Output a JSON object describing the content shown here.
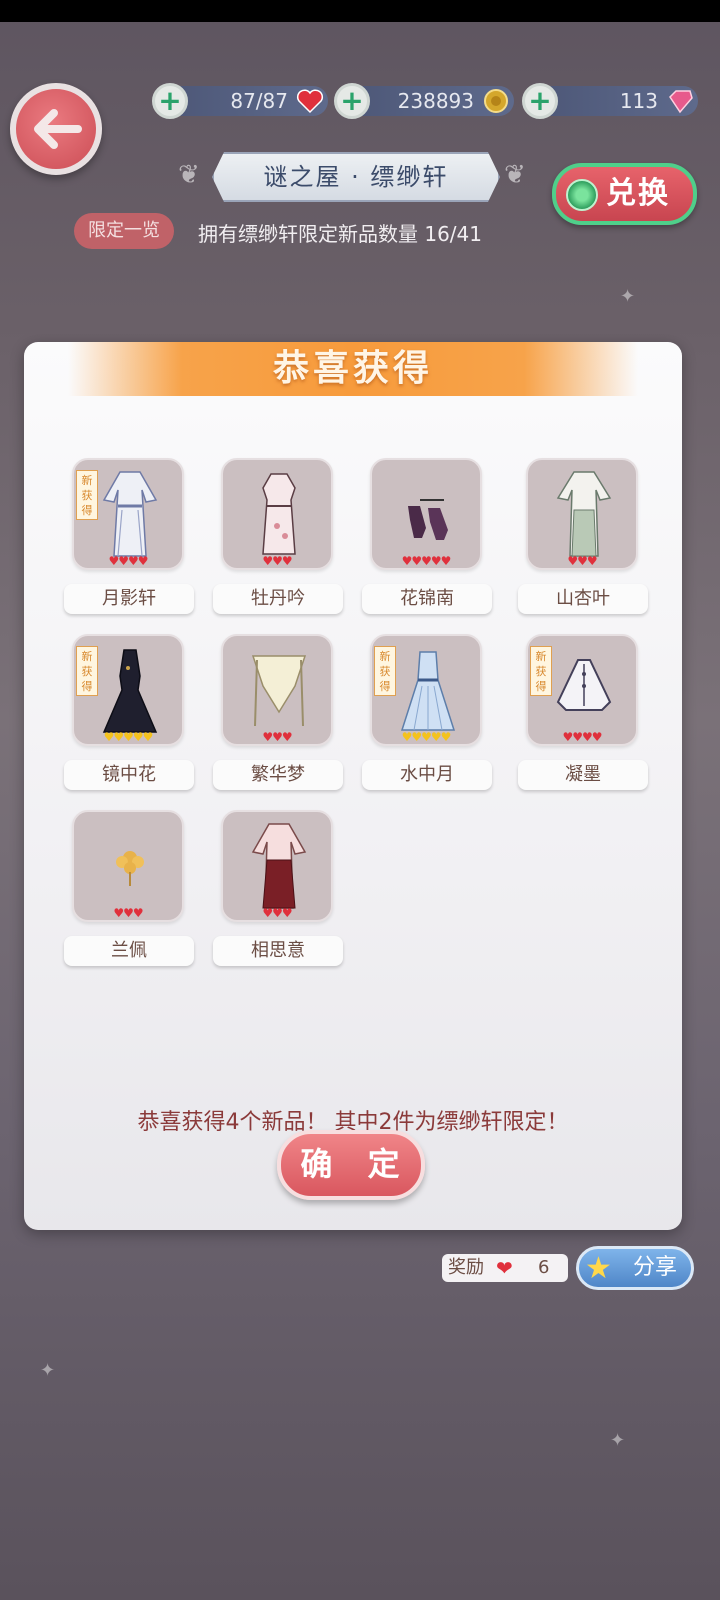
{
  "resources": [
    {
      "value": "87/87",
      "icon": "heart-icon"
    },
    {
      "value": "238893",
      "icon": "coin-icon"
    },
    {
      "value": "113",
      "icon": "gem-icon"
    }
  ],
  "header": {
    "title": "谜之屋 · 缥缈轩",
    "exchange_label": "兑换",
    "limit_label": "限定一览",
    "owned_text": "拥有缥缈轩限定新品数量 16/41"
  },
  "modal": {
    "title": "恭喜获得",
    "items": [
      {
        "name": "月影轩",
        "new": true,
        "rarity": "♥♥♥♥",
        "gold": false
      },
      {
        "name": "牡丹吟",
        "new": false,
        "rarity": "♥♥♥",
        "gold": false
      },
      {
        "name": "花锦南",
        "new": false,
        "rarity": "♥♥♥♥♥",
        "gold": false
      },
      {
        "name": "山杏叶",
        "new": false,
        "rarity": "♥♥♥",
        "gold": false
      },
      {
        "name": "镜中花",
        "new": true,
        "rarity": "♥♥♥♥♥",
        "gold": true
      },
      {
        "name": "繁华梦",
        "new": false,
        "rarity": "♥♥♥",
        "gold": false
      },
      {
        "name": "水中月",
        "new": true,
        "rarity": "♥♥♥♥♥",
        "gold": true
      },
      {
        "name": "凝墨",
        "new": true,
        "rarity": "♥♥♥♥",
        "gold": false
      },
      {
        "name": "兰佩",
        "new": false,
        "rarity": "♥♥♥",
        "gold": false
      },
      {
        "name": "相思意",
        "new": false,
        "rarity": "♥♥♥",
        "gold": false
      }
    ],
    "new_badge": "新获得",
    "message": "恭喜获得4个新品！ 其中2件为缥缈轩限定！",
    "confirm_label": "确 定"
  },
  "footer": {
    "reward_label": "奖励",
    "reward_value": "6",
    "share_label": "分享"
  },
  "colors": {
    "accent_red": "#d9575f",
    "banner_orange": "#f79b3c",
    "heart_red": "#e0303c",
    "gold": "#f4c21e"
  }
}
